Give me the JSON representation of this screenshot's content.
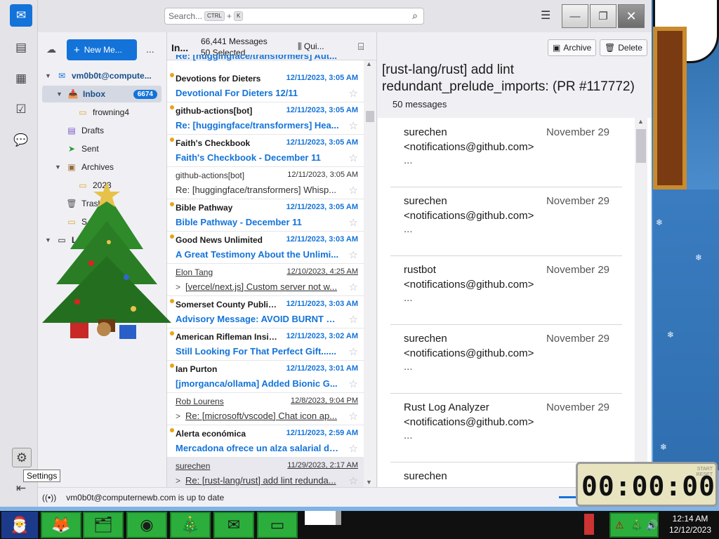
{
  "search": {
    "placeholder": "Search...",
    "key1": "CTRL",
    "plus": "+",
    "key2": "K"
  },
  "folders": {
    "new_message": "New Me...",
    "more": "...",
    "account": "vm0b0t@compute...",
    "items": [
      {
        "label": "Inbox",
        "icon": "inbox-icon",
        "badge": "6674"
      },
      {
        "label": "frowning4",
        "icon": "folder-icon"
      },
      {
        "label": "Drafts",
        "icon": "drafts-icon"
      },
      {
        "label": "Sent",
        "icon": "sent-icon"
      },
      {
        "label": "Archives",
        "icon": "archive-icon"
      },
      {
        "label": "2023",
        "icon": "folder-icon"
      },
      {
        "label": "Trash",
        "icon": "trash-icon"
      },
      {
        "label": "S",
        "icon": "folder-icon"
      },
      {
        "label": "Lo",
        "icon": "local-folders-icon"
      }
    ]
  },
  "list": {
    "folder_short": "In...",
    "count": "66,441 Messages",
    "selected": "50 Selected",
    "quick": "Qui...",
    "partial_top": "Re: [huggingface/transformers] Aut...",
    "messages": [
      {
        "from": "Devotions for Dieters",
        "date": "12/11/2023, 3:05 AM",
        "subject": "Devotional For Dieters 12/11",
        "unread": true
      },
      {
        "from": "github-actions[bot]",
        "date": "12/11/2023, 3:05 AM",
        "subject": "Re: [huggingface/transformers] Hea...",
        "unread": true
      },
      {
        "from": "Faith's Checkbook",
        "date": "12/11/2023, 3:05 AM",
        "subject": "Faith's Checkbook - December 11",
        "unread": true
      },
      {
        "from": "github-actions[bot]",
        "date": "12/11/2023, 3:05 AM",
        "subject": "Re: [huggingface/transformers] Whisp...",
        "unread": false
      },
      {
        "from": "Bible Pathway",
        "date": "12/11/2023, 3:05 AM",
        "subject": "Bible Pathway - December 11",
        "unread": true
      },
      {
        "from": "Good News Unlimited",
        "date": "12/11/2023, 3:03 AM",
        "subject": "A Great Testimony About the Unlimi...",
        "unread": true
      },
      {
        "from": "Elon Tang",
        "date": "12/10/2023, 4:25 AM",
        "subject": "[vercel/next.js] Custom server not w...",
        "unread": false,
        "thread": true
      },
      {
        "from": "Somerset County Public ...",
        "date": "12/11/2023, 3:03 AM",
        "subject": "Advisory Message: AVOID BURNT M...",
        "unread": true
      },
      {
        "from": "American Rifleman Insid...",
        "date": "12/11/2023, 3:02 AM",
        "subject": "Still Looking For That Perfect Gift......",
        "unread": true
      },
      {
        "from": "Ian Purton",
        "date": "12/11/2023, 3:01 AM",
        "subject": "[jmorganca/ollama] Added Bionic G...",
        "unread": true
      },
      {
        "from": "Rob Lourens",
        "date": "12/8/2023, 9:04 PM",
        "subject": "Re: [microsoft/vscode] Chat icon ap...",
        "unread": false,
        "thread": true
      },
      {
        "from": "Alerta económica",
        "date": "12/11/2023, 2:59 AM",
        "subject": "Mercadona ofrece un alza salarial de...",
        "unread": true
      },
      {
        "from": "surechen",
        "date": "11/29/2023, 2:17 AM",
        "subject": "Re: [rust-lang/rust] add lint redunda...",
        "unread": false,
        "thread": true,
        "selected": true
      }
    ]
  },
  "reader": {
    "archive": "Archive",
    "delete": "Delete",
    "title": "[rust-lang/rust] add lint redundant_prelude_imports: (PR #117772)",
    "count": "50 messages",
    "cards": [
      {
        "name": "surechen",
        "email": "<notifications@github.com>",
        "date": "November 29",
        "snippet": "..."
      },
      {
        "name": "surechen",
        "email": "<notifications@github.com>",
        "date": "November 29",
        "snippet": "..."
      },
      {
        "name": "rustbot",
        "email": "<notifications@github.com>",
        "date": "November 29",
        "snippet": "..."
      },
      {
        "name": "surechen",
        "email": "<notifications@github.com>",
        "date": "November 29",
        "snippet": "..."
      },
      {
        "name": "Rust Log Analyzer",
        "email": "<notifications@github.com>",
        "date": "November 29",
        "snippet": "..."
      },
      {
        "name": "surechen",
        "email": "",
        "date": "Novem",
        "snippet": ""
      }
    ]
  },
  "status": {
    "text": "vm0b0t@computernewb.com is up to date"
  },
  "tooltip": "Settings",
  "widget": {
    "time": "00:00:00",
    "mini1": "START",
    "mini2": "RESET"
  },
  "taskbar": {
    "time": "12:14 AM",
    "date": "12/12/2023"
  },
  "colors": {
    "accent": "#1373d9",
    "unread_dot": "#e8a317",
    "taskbar_green": "#2cae3c"
  }
}
